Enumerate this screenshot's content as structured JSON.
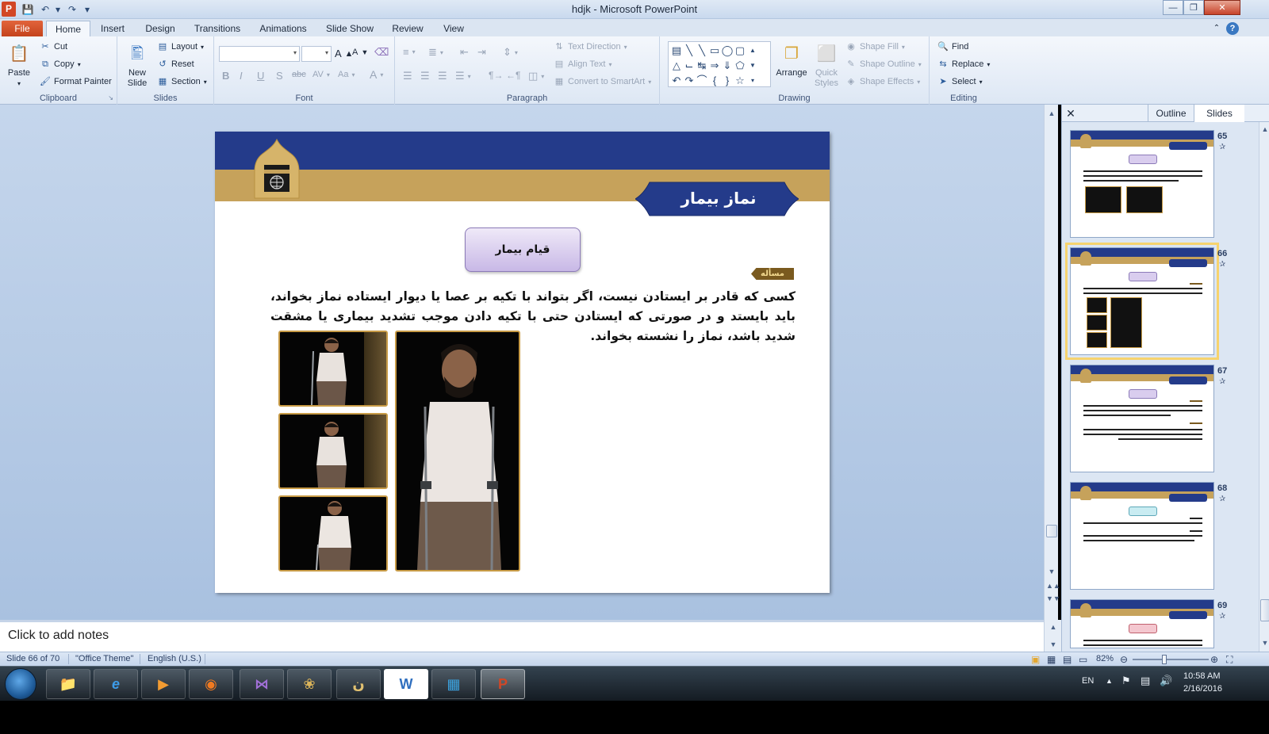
{
  "window": {
    "title": "hdjk  -  Microsoft PowerPoint",
    "app_icon_letter": "P",
    "controls": [
      "minimize",
      "restore",
      "close"
    ]
  },
  "quick_access": [
    "save-icon",
    "undo-icon",
    "redo-icon",
    "customize-icon"
  ],
  "ribbon": {
    "tabs": [
      "File",
      "Home",
      "Insert",
      "Design",
      "Transitions",
      "Animations",
      "Slide Show",
      "Review",
      "View"
    ],
    "active_tab": "Home",
    "clipboard": {
      "label": "Clipboard",
      "paste": "Paste",
      "cut": "Cut",
      "copy": "Copy",
      "format_painter": "Format Painter"
    },
    "slides": {
      "label": "Slides",
      "new_slide": "New Slide",
      "layout": "Layout",
      "reset": "Reset",
      "section": "Section"
    },
    "font": {
      "label": "Font",
      "bold": "B",
      "italic": "I",
      "underline": "U",
      "shadow": "S",
      "strike": "abc",
      "spacing": "AV",
      "case": "Aa",
      "color": "A"
    },
    "paragraph": {
      "label": "Paragraph",
      "text_direction": "Text Direction",
      "align_text": "Align Text",
      "convert_smartart": "Convert to SmartArt"
    },
    "drawing": {
      "label": "Drawing",
      "arrange": "Arrange",
      "quick_styles": "Quick Styles",
      "shape_fill": "Shape Fill",
      "shape_outline": "Shape Outline",
      "shape_effects": "Shape Effects"
    },
    "editing": {
      "label": "Editing",
      "find": "Find",
      "replace": "Replace",
      "select": "Select"
    }
  },
  "slide": {
    "title": "نماز بیمار",
    "subtitle": "قیام بیمار",
    "tag": "مسأله",
    "body": "کسی که قادر بر ایستادن نیست، اگر بتواند با تکیه بر عصا یا دیوار ایستاده نماز بخواند، باید بایستد و در صورتی که ایستادن حتی با تکیه دادن موجب تشدید بیماری یا مشقت شدید باشد، نماز را نشسته بخواند.",
    "colors": {
      "navy": "#243b8a",
      "gold": "#c6a25b",
      "subtitle_fill": "#d8ccee",
      "photo_border": "#c89b46"
    }
  },
  "panel": {
    "tabs": [
      "Outline",
      "Slides"
    ],
    "active_tab": "Slides",
    "thumbnails": [
      {
        "number": "65",
        "selected": false
      },
      {
        "number": "66",
        "selected": true
      },
      {
        "number": "67",
        "selected": false
      },
      {
        "number": "68",
        "selected": false
      },
      {
        "number": "69",
        "selected": false
      }
    ]
  },
  "notes": {
    "placeholder": "Click to add notes"
  },
  "status": {
    "slide_info": "Slide 66 of 70",
    "theme": "\"Office Theme\"",
    "language": "English (U.S.)",
    "zoom": "82%",
    "zoom_level": 0.42
  },
  "taskbar": {
    "apps": [
      "explorer",
      "internet-explorer",
      "media-player",
      "firefox",
      "visual-studio",
      "noor-app",
      "noor-app-2",
      "word",
      "network-app",
      "powerpoint"
    ],
    "active_app": "powerpoint",
    "language": "EN",
    "time": "10:58 AM",
    "date": "2/16/2016"
  }
}
